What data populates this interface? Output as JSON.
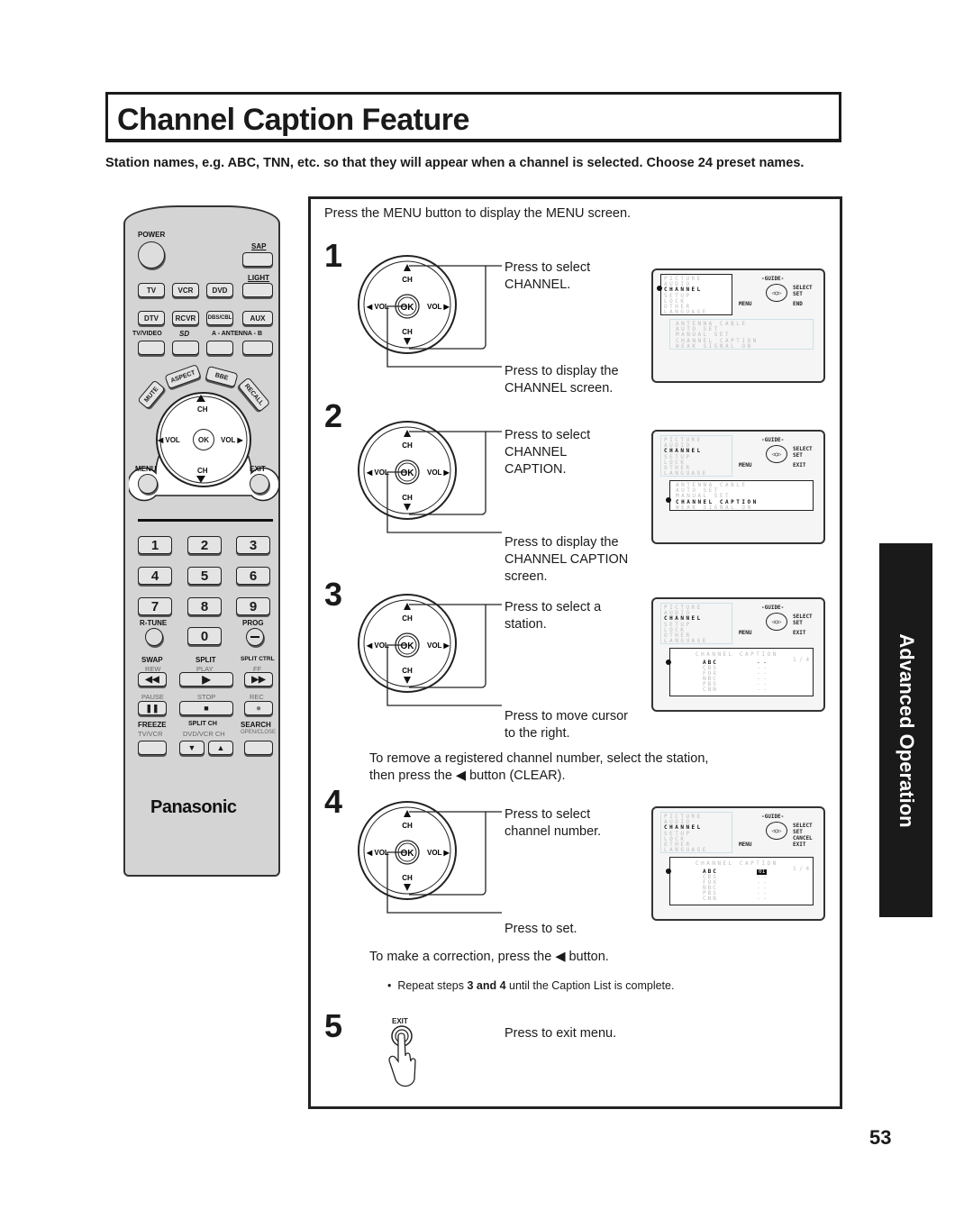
{
  "title": "Channel Caption Feature",
  "intro": "Station names, e.g. ABC, TNN, etc. so that they will appear when a channel is selected. Choose 24 preset names.",
  "remote": {
    "power": "POWER",
    "sap": "SAP",
    "light": "LIGHT",
    "row1": [
      "TV",
      "VCR",
      "DVD"
    ],
    "row2": [
      "DTV",
      "RCVR",
      "DBS/CBL",
      "AUX"
    ],
    "tv_video": "TV/VIDEO",
    "sd": "SD",
    "antenna": "A - ANTENNA - B",
    "mute": "MUTE",
    "aspect": "ASPECT",
    "bbe": "BBE",
    "recall": "RECALL",
    "ch": "CH",
    "vol": "VOL",
    "ok": "OK",
    "menu": "MENU",
    "exit": "EXIT",
    "numbers": [
      "1",
      "2",
      "3",
      "4",
      "5",
      "6",
      "7",
      "8",
      "9",
      "0"
    ],
    "rtune": "R-TUNE",
    "prog": "PROG",
    "swap": "SWAP",
    "rew": "REW",
    "split": "SPLIT",
    "play": "PLAY",
    "split_ctrl": "SPLIT CTRL",
    "ff": "FF",
    "pause": "PAUSE",
    "stop": "STOP",
    "rec": "REC",
    "freeze": "FREEZE",
    "tv_vcr": "TV/VCR",
    "split_ch": "SPLIT CH",
    "dvd_vcr_ch": "DVD/VCR CH",
    "search": "SEARCH",
    "open_close": "OPEN/CLOSE",
    "brand": "Panasonic"
  },
  "main": {
    "lead": "Press the MENU button to display the MENU screen.",
    "steps": [
      {
        "num": "1",
        "top": "Press to select\nCHANNEL.",
        "top_lines": [
          "Press to select",
          "CHANNEL."
        ],
        "bottom_lines": [
          "Press to display the",
          "CHANNEL screen."
        ]
      },
      {
        "num": "2",
        "top_lines": [
          "Press to select",
          "CHANNEL",
          "CAPTION."
        ],
        "bottom_lines": [
          "Press to display the",
          "CHANNEL CAPTION",
          "screen."
        ]
      },
      {
        "num": "3",
        "top_lines": [
          "Press to select a",
          "station."
        ],
        "bottom_lines": [
          "Press to move cursor",
          "to the right."
        ],
        "note_lines": [
          "To remove a registered channel number, select the station,",
          "then press the ◀ button (CLEAR)."
        ]
      },
      {
        "num": "4",
        "top_lines": [
          "Press to select",
          "channel number."
        ],
        "bottom_lines": [
          "Press to set."
        ],
        "note": "To make a correction, press the ◀ button."
      },
      {
        "num": "5",
        "exit_label": "EXIT",
        "text": "Press to exit menu."
      }
    ],
    "bullet_pre": "Repeat steps ",
    "bullet_bold": "3 and 4",
    "bullet_post": " until the Caption List is complete."
  },
  "osd": {
    "menu_items": [
      "PICTURE",
      "AUDIO",
      "CHANNEL",
      "SETUP",
      "LOCK",
      "OTHER",
      "LANGUAGE"
    ],
    "guide": "-GUIDE-",
    "select": "SELECT",
    "set": "SET",
    "cancel": "CANCEL",
    "menu": "MENU",
    "end": "END",
    "exit": "EXIT",
    "channel_items": [
      "ANTENNA      CABLE",
      "AUTO SET",
      "MANUAL SET",
      "CHANNEL CAPTION",
      "WEAK SIGNAL    ON"
    ],
    "caption_title": "CHANNEL CAPTION",
    "caption_page": "1 / 4",
    "stations": [
      "ABC",
      "CBS",
      "FOX",
      "NBC",
      "PBS",
      "CNN"
    ],
    "empty_value": "- -",
    "set_value": "01"
  },
  "side_tab": "Advanced Operation",
  "page_number": "53"
}
